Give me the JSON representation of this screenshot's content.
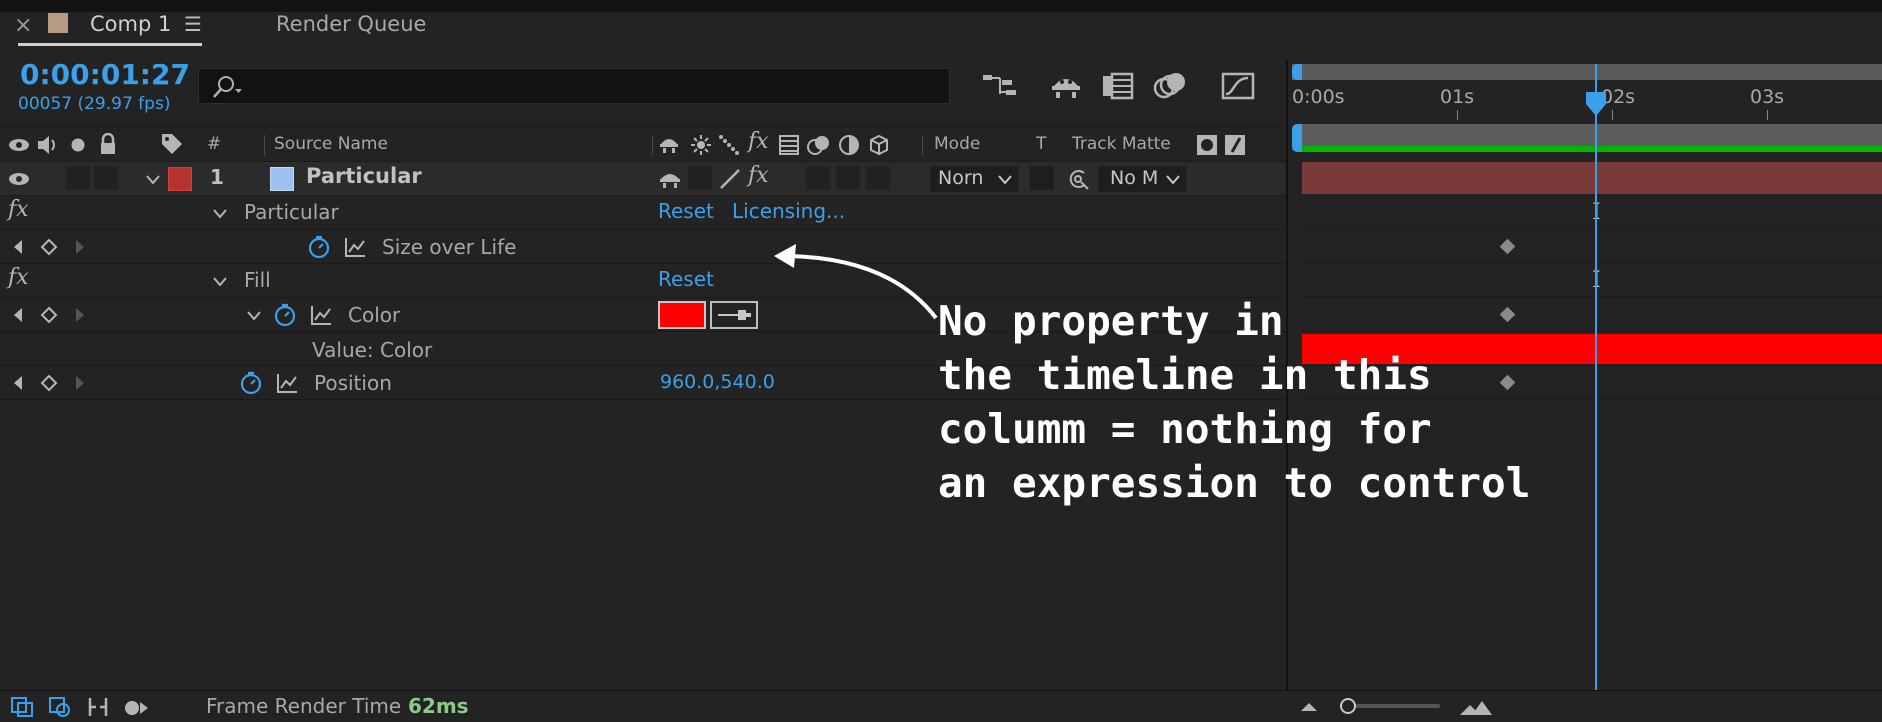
{
  "tabs": {
    "close_glyph": "×",
    "comp_label": "Comp 1",
    "menu_glyph": "☰",
    "render_label": "Render Queue",
    "comp_swatch": "#b49c82"
  },
  "time": {
    "timecode": "0:00:01:27",
    "frame_info": "00057 (29.97 fps)"
  },
  "search": {
    "placeholder": ""
  },
  "columns": {
    "number": "#",
    "source_name": "Source Name",
    "mode": "Mode",
    "t": "T",
    "track_matte": "Track Matte"
  },
  "layer": {
    "number": "1",
    "name": "Particular",
    "label_color": "#b83232",
    "source_color": "#9cc0f0",
    "mode_value": "Norn",
    "matte_value": "No M"
  },
  "properties": {
    "fx_glyph": "fx",
    "particular_effect": "Particular",
    "reset": "Reset",
    "licensing": "Licensing...",
    "size_over_life": "Size over Life",
    "fill_effect": "Fill",
    "fill_reset": "Reset",
    "color": "Color",
    "color_value": "#ff0000",
    "value_color": "Value: Color",
    "position": "Position",
    "position_value": "960.0,540.0"
  },
  "timeline": {
    "ruler": [
      "0:00s",
      "01s",
      "02s",
      "03s"
    ],
    "playhead_s": 1.9,
    "layer_bar_color": "#7a3a3a",
    "color_graph_color": "#ff0000",
    "work_area_color": "#00b400"
  },
  "annotation": {
    "lines": [
      "No property in",
      "the timeline in this",
      "columm = nothing for",
      "an expression to control"
    ]
  },
  "footer": {
    "frame_render_label": "Frame Render Time",
    "frame_render_value": "62ms"
  }
}
